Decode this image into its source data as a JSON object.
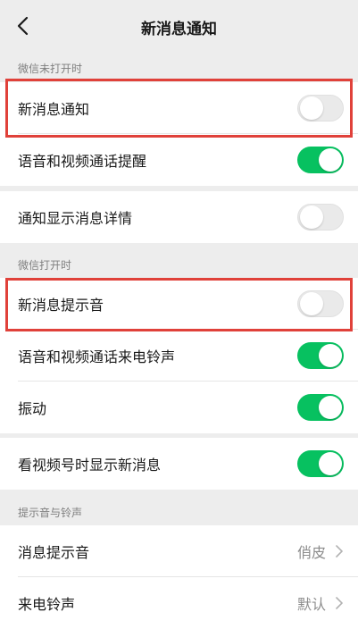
{
  "nav": {
    "title": "新消息通知",
    "back_icon": "chevron-left-icon"
  },
  "sections": {
    "closed_header": "微信未打开时",
    "open_header": "微信打开时",
    "sound_header": "提示音与铃声"
  },
  "rows": {
    "new_message_notify": {
      "label": "新消息通知",
      "enabled": false
    },
    "voice_video_remind": {
      "label": "语音和视频通话提醒",
      "enabled": true
    },
    "show_message_detail": {
      "label": "通知显示消息详情",
      "enabled": false
    },
    "new_message_sound": {
      "label": "新消息提示音",
      "enabled": false
    },
    "voice_video_ringtone": {
      "label": "语音和视频通话来电铃声",
      "enabled": true
    },
    "vibrate": {
      "label": "振动",
      "enabled": true
    },
    "channels_show_new": {
      "label": "看视频号时显示新消息",
      "enabled": true
    },
    "message_tone": {
      "label": "消息提示音",
      "value": "俏皮"
    },
    "ringtone": {
      "label": "来电铃声",
      "value": "默认"
    }
  },
  "colors": {
    "accent_green": "#07c160",
    "highlight_red": "#e0413a",
    "background": "#ededed"
  }
}
